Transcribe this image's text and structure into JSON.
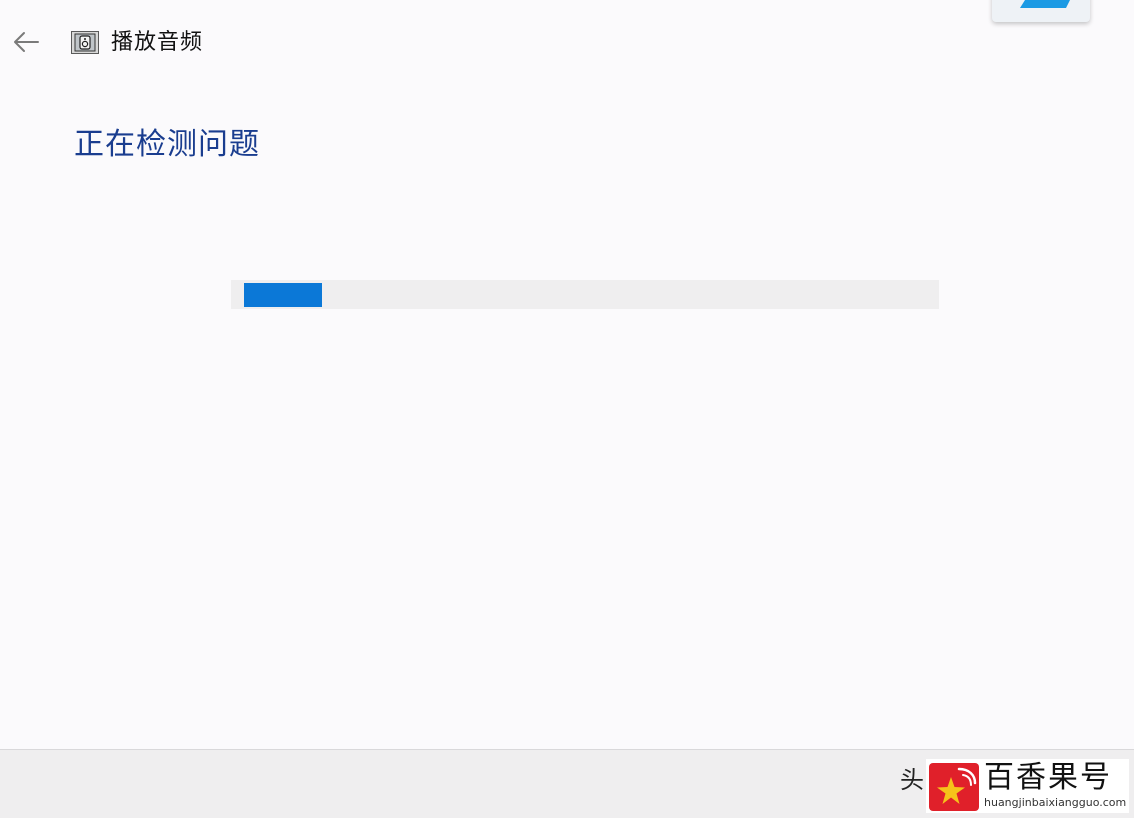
{
  "window": {
    "title": "播放音频"
  },
  "main": {
    "heading": "正在检测问题",
    "progress": {
      "value": 0.11,
      "offset": 0.018,
      "fill_color": "#0b78d7",
      "track_color": "#efeeef"
    }
  },
  "icons": {
    "back": "back-arrow-icon",
    "app": "audio-troubleshooter-icon"
  },
  "watermark": {
    "prefix": "头",
    "brand": "百香果号",
    "url": "huangjinbaixiangguo.com"
  },
  "colors": {
    "heading": "#1a3d8f",
    "background": "#fbfafc",
    "footer": "#efeeef",
    "logo_red": "#e0202a",
    "logo_gold": "#f6c21a"
  }
}
